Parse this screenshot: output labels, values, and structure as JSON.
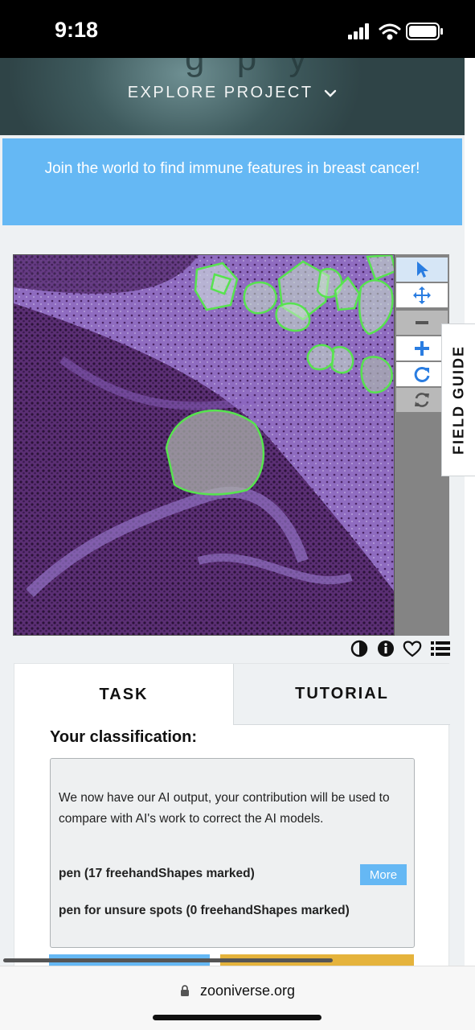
{
  "status_bar": {
    "time": "9:18",
    "icons": [
      "signal-icon",
      "wifi-icon",
      "battery-icon"
    ]
  },
  "header": {
    "explore_label": "EXPLORE PROJECT"
  },
  "announcement": {
    "text": "Join the world to find immune features in breast cancer!"
  },
  "toolbar": {
    "tools": [
      "select-pointer-icon",
      "pan-move-icon",
      "zoom-out-icon",
      "zoom-in-icon",
      "rotate-icon",
      "reset-icon"
    ]
  },
  "field_guide": {
    "label": "FIELD GUIDE"
  },
  "image_meta_icons": [
    "contrast-icon",
    "info-icon",
    "favorite-heart-icon",
    "collections-list-icon"
  ],
  "tabs": {
    "task": "TASK",
    "tutorial": "TUTORIAL"
  },
  "classification": {
    "heading": "Your classification:",
    "message": "We now have our AI output, your contribution will be used to compare with AI's work to correct the AI models.",
    "lines": [
      "pen (17 freehandShapes marked)",
      "pen for unsure spots (0 freehandShapes marked)"
    ],
    "more_label": "More"
  },
  "browser": {
    "url": "zooniverse.org"
  },
  "colors": {
    "accent_blue": "#65b8f4",
    "annotation_green": "#57e34f",
    "tissue_purple": "#7a4fa2",
    "done_gold": "#e5b33c"
  }
}
